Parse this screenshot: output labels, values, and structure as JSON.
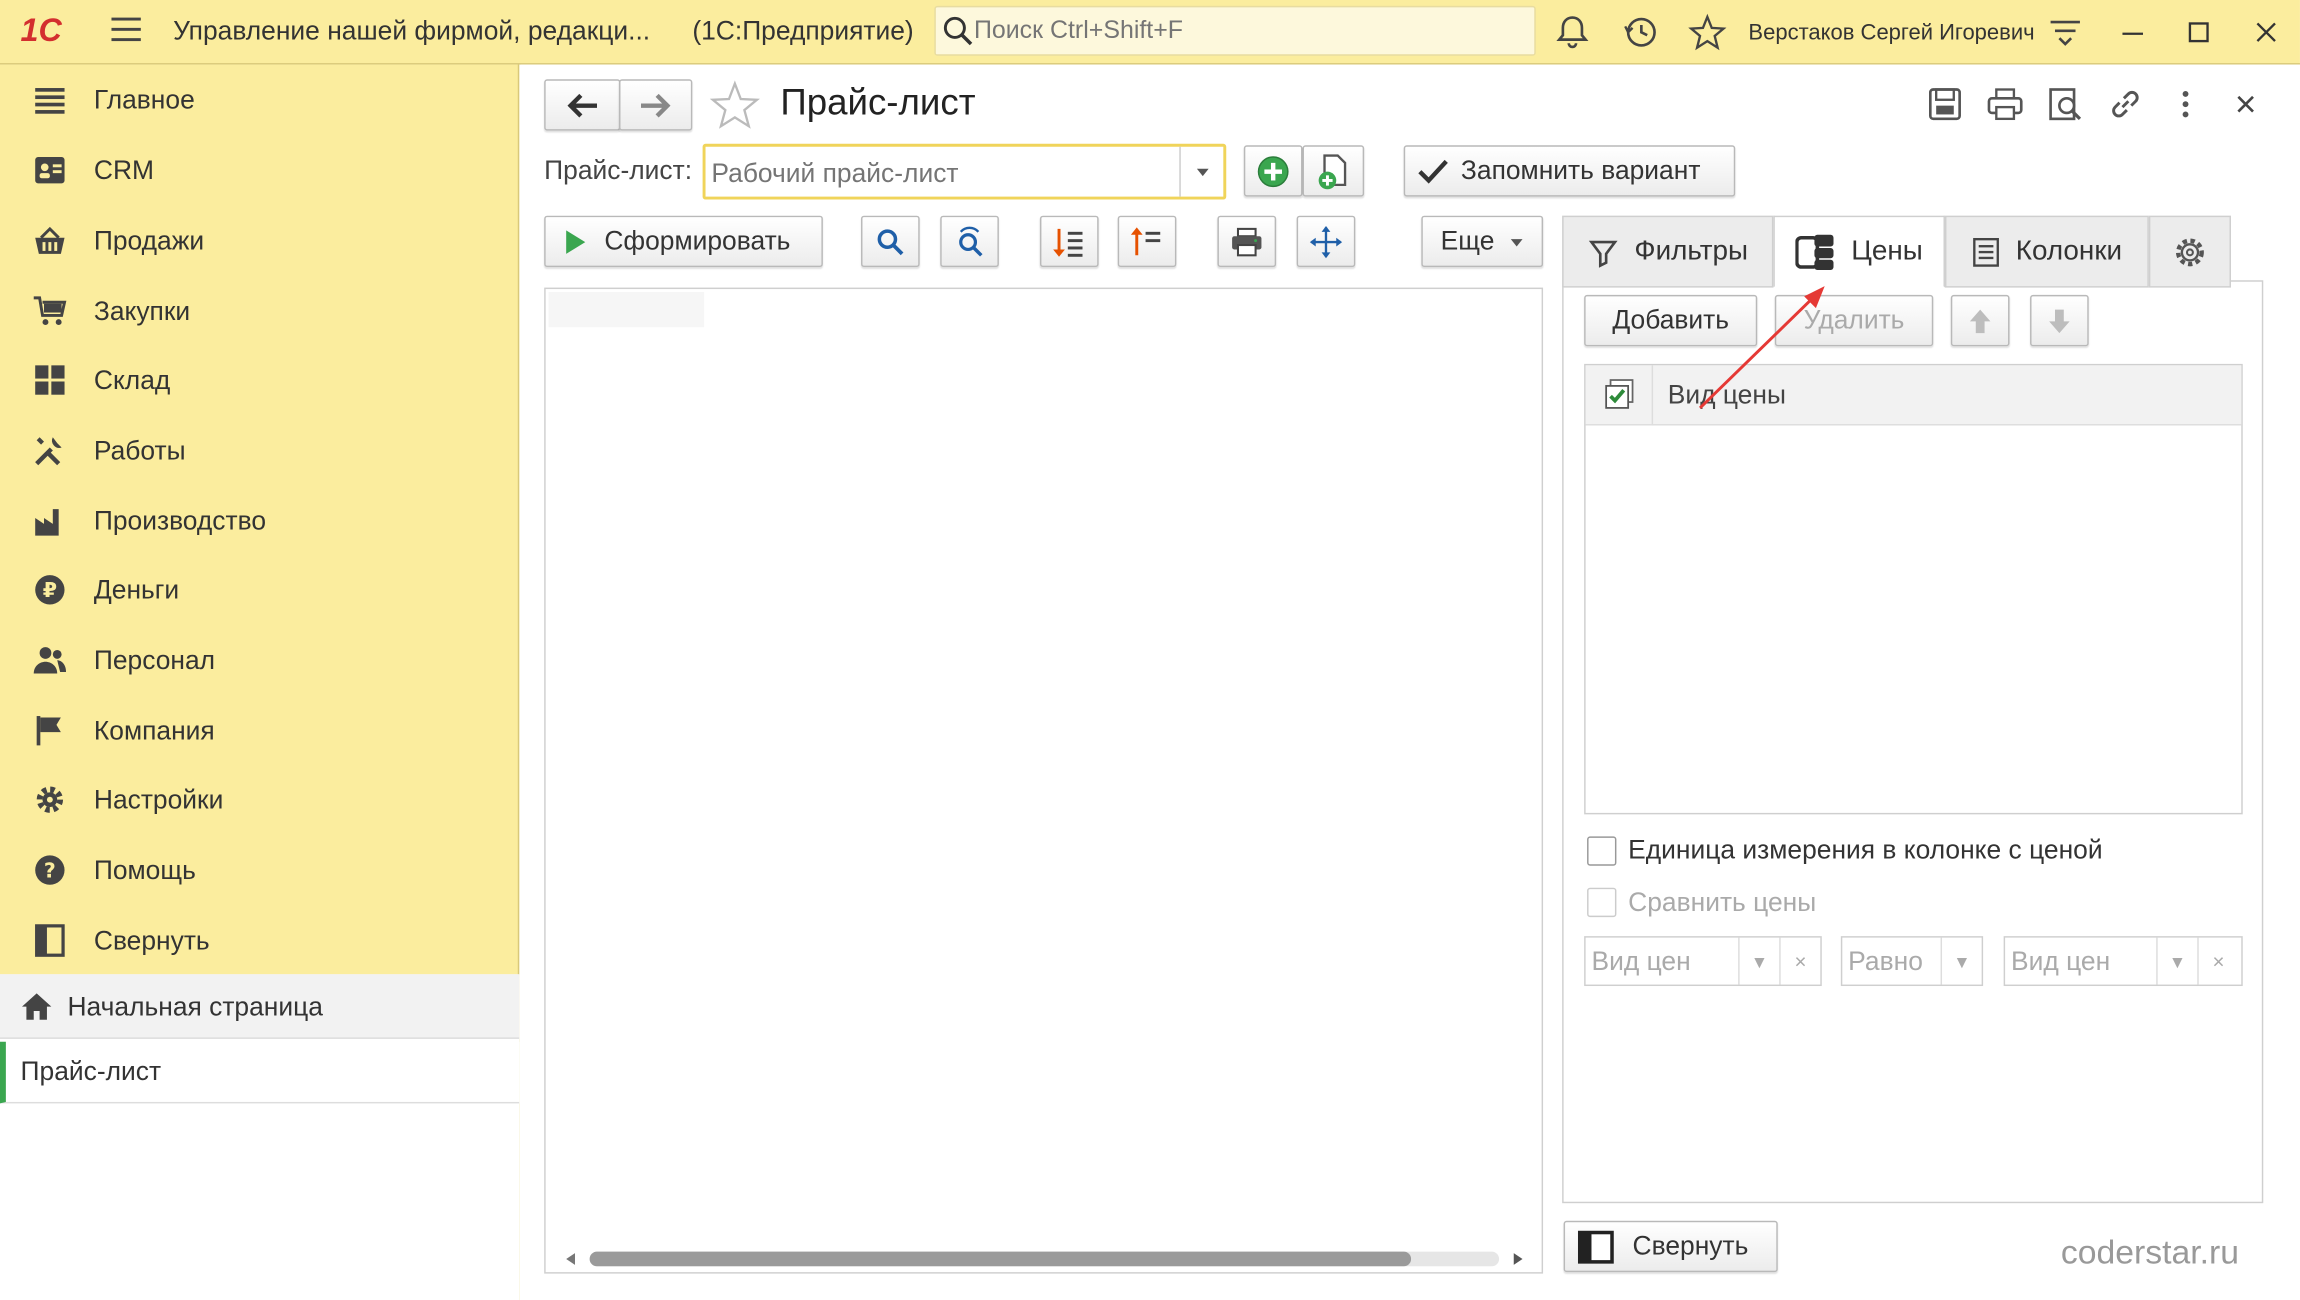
{
  "titlebar": {
    "logo": "1С",
    "app_title": "Управление нашей фирмой, редакци...",
    "app_subtitle": "(1С:Предприятие)",
    "search_placeholder": "Поиск Ctrl+Shift+F",
    "user_name": "Верстаков Сергей Игоревич"
  },
  "sidebar": {
    "items": [
      {
        "label": "Главное",
        "icon": "menu-list-icon"
      },
      {
        "label": "CRM",
        "icon": "contact-card-icon"
      },
      {
        "label": "Продажи",
        "icon": "basket-icon"
      },
      {
        "label": "Закупки",
        "icon": "cart-icon"
      },
      {
        "label": "Склад",
        "icon": "warehouse-icon"
      },
      {
        "label": "Работы",
        "icon": "tools-icon"
      },
      {
        "label": "Производство",
        "icon": "factory-icon"
      },
      {
        "label": "Деньги",
        "icon": "ruble-icon"
      },
      {
        "label": "Персонал",
        "icon": "people-icon"
      },
      {
        "label": "Компания",
        "icon": "flag-icon"
      },
      {
        "label": "Настройки",
        "icon": "gear-icon"
      },
      {
        "label": "Помощь",
        "icon": "help-icon"
      },
      {
        "label": "Свернуть",
        "icon": "collapse-panel-icon"
      }
    ],
    "home_label": "Начальная страница",
    "open_page_label": "Прайс-лист"
  },
  "form": {
    "title": "Прайс-лист",
    "price_list_label": "Прайс-лист:",
    "price_list_placeholder": "Рабочий прайс-лист",
    "save_variant_label": "Запомнить вариант",
    "generate_label": "Сформировать",
    "more_label": "Еще"
  },
  "panel": {
    "tabs": [
      {
        "label": "Фильтры",
        "icon": "filter-icon"
      },
      {
        "label": "Цены",
        "icon": "prices-icon"
      },
      {
        "label": "Колонки",
        "icon": "columns-icon"
      }
    ],
    "add_label": "Добавить",
    "delete_label": "Удалить",
    "grid_column": "Вид цены",
    "unit_in_price_column": "Единица измерения в колонке с ценой",
    "compare_prices": "Сравнить цены",
    "price_kind_1": "Вид цен",
    "equals": "Равно",
    "price_kind_2": "Вид цен",
    "collapse_label": "Свернуть"
  },
  "watermark": "coderstar.ru",
  "colors": {
    "chrome_yellow": "#fbed9e",
    "active_green": "#3aa64f",
    "focus_yellow": "#f0d45a",
    "arrow_red": "#e53935"
  }
}
